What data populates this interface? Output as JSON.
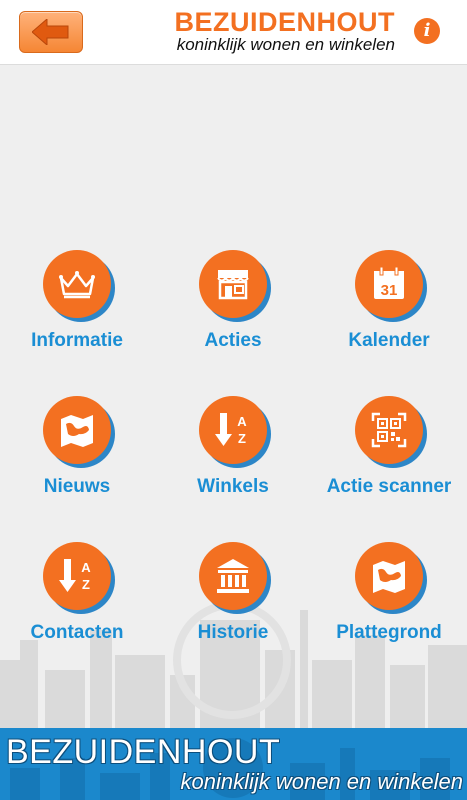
{
  "header": {
    "title": "BEZUIDENHOUT",
    "subtitle": "koninklijk wonen en winkelen",
    "back_icon": "arrow-left-icon",
    "info_label": "i"
  },
  "menu": [
    {
      "label": "Informatie",
      "icon": "crown-icon"
    },
    {
      "label": "Acties",
      "icon": "shop-icon"
    },
    {
      "label": "Kalender",
      "icon": "calendar-icon",
      "icon_text": "31"
    },
    {
      "label": "Nieuws",
      "icon": "map-icon"
    },
    {
      "label": "Winkels",
      "icon": "sort-az-icon"
    },
    {
      "label": "Actie scanner",
      "icon": "qr-code-icon"
    },
    {
      "label": "Contacten",
      "icon": "sort-az-icon"
    },
    {
      "label": "Historie",
      "icon": "building-icon"
    },
    {
      "label": "Plattegrond",
      "icon": "map-icon"
    }
  ],
  "footer": {
    "title": "BEZUIDENHOUT",
    "subtitle": "koninklijk wonen en winkelen"
  },
  "colors": {
    "accent": "#f37021",
    "label": "#1a8ed4",
    "footer": "#1b88cc"
  }
}
